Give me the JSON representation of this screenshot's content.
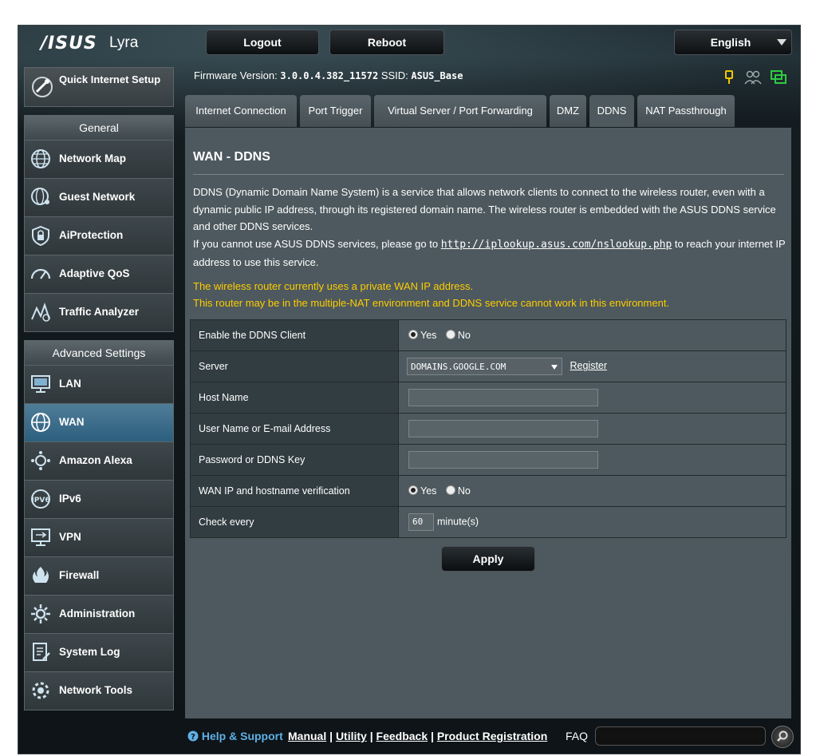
{
  "brand": {
    "logo": "/ISUS",
    "model": "Lyra"
  },
  "top_buttons": {
    "logout": "Logout",
    "reboot": "Reboot",
    "language": "English"
  },
  "firmware": {
    "label": "Firmware Version:",
    "version": "3.0.0.4.382_11572",
    "ssid_label": "SSID:",
    "ssid": "ASUS_Base"
  },
  "status_icons": [
    "usb-status-icon",
    "clients-status-icon",
    "internet-status-icon"
  ],
  "sidebar": {
    "quick_setup": "Quick Internet Setup",
    "general_title": "General",
    "general_items": [
      {
        "label": "Network Map",
        "icon": "globe-icon"
      },
      {
        "label": "Guest Network",
        "icon": "globe-people-icon"
      },
      {
        "label": "AiProtection",
        "icon": "lock-shield-icon"
      },
      {
        "label": "Adaptive QoS",
        "icon": "speedometer-icon"
      },
      {
        "label": "Traffic Analyzer",
        "icon": "traffic-chart-icon"
      }
    ],
    "advanced_title": "Advanced Settings",
    "advanced_items": [
      {
        "label": "LAN",
        "icon": "lan-monitor-icon"
      },
      {
        "label": "WAN",
        "icon": "wan-globe-icon",
        "active": true
      },
      {
        "label": "Amazon Alexa",
        "icon": "alexa-icon"
      },
      {
        "label": "IPv6",
        "icon": "ipv6-icon"
      },
      {
        "label": "VPN",
        "icon": "vpn-monitor-icon"
      },
      {
        "label": "Firewall",
        "icon": "firewall-icon"
      },
      {
        "label": "Administration",
        "icon": "admin-gear-icon"
      },
      {
        "label": "System Log",
        "icon": "system-log-icon"
      },
      {
        "label": "Network Tools",
        "icon": "network-tools-icon"
      }
    ]
  },
  "tabs": [
    {
      "label": "Internet Connection"
    },
    {
      "label": "Port Trigger"
    },
    {
      "label": "Virtual Server / Port Forwarding"
    },
    {
      "label": "DMZ"
    },
    {
      "label": "DDNS",
      "active": true
    },
    {
      "label": "NAT Passthrough"
    }
  ],
  "main": {
    "title": "WAN - DDNS",
    "description": "DDNS (Dynamic Domain Name System) is a service that allows network clients to connect to the wireless router, even with a dynamic public IP address, through its registered domain name. The wireless router is embedded with the ASUS DDNS service and other DDNS services.",
    "lookup_prefix": "If you cannot use ASUS DDNS services, please go to ",
    "lookup_link": "http://iplookup.asus.com/nslookup.php",
    "lookup_suffix": " to reach your internet IP address to use this service.",
    "warning1": "The wireless router currently uses a private WAN IP address.",
    "warning2": "This router may be in the multiple-NAT environment and DDNS service cannot work in this environment.",
    "form": {
      "enable_label": "Enable the DDNS Client",
      "yes": "Yes",
      "no": "No",
      "enable_value": "Yes",
      "server_label": "Server",
      "server_value": "DOMAINS.GOOGLE.COM",
      "register_link": "Register",
      "host_label": "Host Name",
      "host_value": "",
      "user_label": "User Name or E-mail Address",
      "user_value": "",
      "password_label": "Password or DDNS Key",
      "password_value": "",
      "verify_label": "WAN IP and hostname verification",
      "verify_value": "Yes",
      "check_label": "Check every",
      "check_value": "60",
      "check_unit": "minute(s)"
    },
    "apply_label": "Apply"
  },
  "footer": {
    "help": "Help & Support",
    "links": [
      "Manual",
      "Utility",
      "Feedback",
      "Product Registration"
    ],
    "faq_label": "FAQ",
    "faq_value": ""
  },
  "colors": {
    "accent_active": "#2c5f7e",
    "warning": "#ffcc00",
    "help": "#5fb0e6",
    "panel": "#4d595e"
  }
}
